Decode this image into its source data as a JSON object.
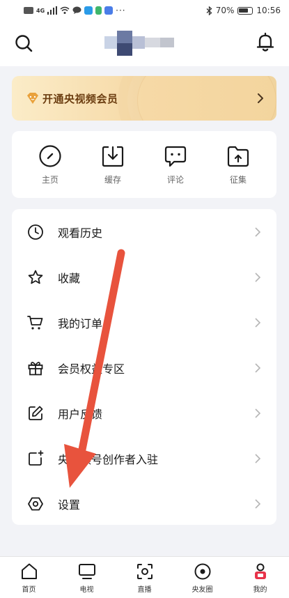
{
  "status_bar": {
    "battery": "70%",
    "time": "10:56",
    "left_icons": [
      "hd-icon",
      "signal-4g-icon",
      "signal-icon",
      "wifi-icon",
      "message-icon",
      "app-q-icon",
      "app-green-icon",
      "app-blue-icon",
      "more-dots-icon"
    ]
  },
  "header": {
    "search_icon": "search-icon",
    "bell_icon": "bell-icon"
  },
  "vip": {
    "label": "开通央视频会员"
  },
  "quick_actions": [
    {
      "label": "主页",
      "icon": "compass-icon"
    },
    {
      "label": "缓存",
      "icon": "download-icon"
    },
    {
      "label": "评论",
      "icon": "comment-icon"
    },
    {
      "label": "征集",
      "icon": "folder-upload-icon"
    }
  ],
  "menu": [
    {
      "label": "观看历史",
      "icon": "clock-icon"
    },
    {
      "label": "收藏",
      "icon": "star-icon"
    },
    {
      "label": "我的订单",
      "icon": "cart-icon"
    },
    {
      "label": "会员权益专区",
      "icon": "gift-icon"
    },
    {
      "label": "用户反馈",
      "icon": "edit-icon"
    },
    {
      "label": "央视频号创作者入驻",
      "icon": "creator-icon"
    },
    {
      "label": "设置",
      "icon": "settings-icon"
    }
  ],
  "tabs": [
    {
      "label": "首页",
      "icon": "home-icon"
    },
    {
      "label": "电视",
      "icon": "tv-icon"
    },
    {
      "label": "直播",
      "icon": "live-icon"
    },
    {
      "label": "央友圈",
      "icon": "circle-icon"
    },
    {
      "label": "我的",
      "icon": "profile-icon"
    }
  ],
  "colors": {
    "accent_arrow": "#e8533d",
    "vip_text": "#6b3d10",
    "background": "#f2f3f7"
  }
}
